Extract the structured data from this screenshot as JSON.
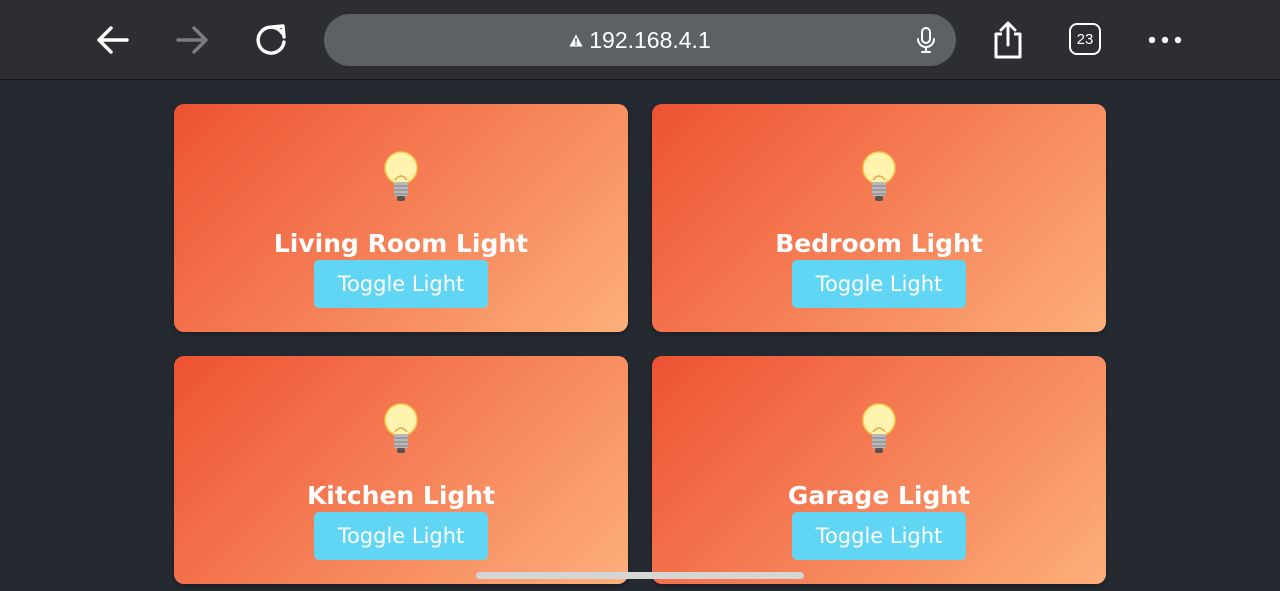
{
  "browser": {
    "url": "192.168.4.1",
    "tab_count": "23",
    "icons": {
      "back": "arrow-left-icon",
      "forward": "arrow-right-icon",
      "reload": "reload-icon",
      "warning": "warning-triangle-icon",
      "mic": "microphone-icon",
      "share": "share-icon",
      "tabs": "tabs-icon",
      "more": "more-dots-icon"
    },
    "forward_disabled": true
  },
  "cards": [
    {
      "icon": "lightbulb-icon",
      "title": "Living Room Light",
      "button_label": "Toggle Light"
    },
    {
      "icon": "lightbulb-icon",
      "title": "Bedroom Light",
      "button_label": "Toggle Light"
    },
    {
      "icon": "lightbulb-icon",
      "title": "Kitchen Light",
      "button_label": "Toggle Light"
    },
    {
      "icon": "lightbulb-icon",
      "title": "Garage Light",
      "button_label": "Toggle Light"
    }
  ],
  "colors": {
    "page_background": "#252a31",
    "toolbar_background": "#2c2e31",
    "card_gradient_start": "#ee5232",
    "card_gradient_end": "#fdaf7a",
    "button_background": "#60d6f4",
    "button_text": "#ffffff"
  }
}
